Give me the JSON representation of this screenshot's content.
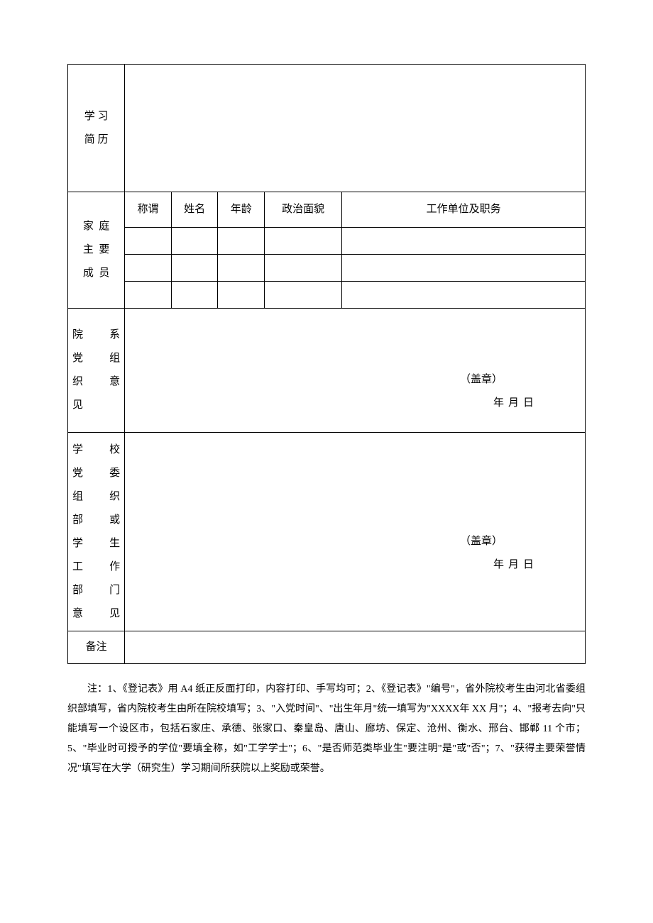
{
  "labels": {
    "study_resume": "学  习\n简  历",
    "family": "家  庭主  要成  员",
    "dept_opinion": "院系党组织意见",
    "school_opinion": "学校党委组织部或学生工作部门意见",
    "remark": "备注"
  },
  "family_headers": {
    "relation": "称谓",
    "name": "姓名",
    "age": "年龄",
    "political": "政治面貌",
    "work": "工作单位及职务"
  },
  "stamp": "（盖章）",
  "date": "年月日",
  "notes_text": "注：1、《登记表》用 A4 纸正反面打印，内容打印、手写均可；2、《登记表》\"编号\"，省外院校考生由河北省委组织部填写，省内院校考生由所在院校填写；3、\"入党时间\"、\"出生年月\"统一填写为\"XXXX年 XX 月\"；4、\"报考去向\"只能填写一个设区市，包括石家庄、承德、张家口、秦皇岛、唐山、廊坊、保定、沧州、衡水、邢台、邯郸 11 个市；5、\"毕业时可授予的学位\"要填全称，如\"工学学士\"；6、\"是否师范类毕业生\"要注明\"是\"或\"否\"；7、\"获得主要荣誉情况\"填写在大学（研究生）学习期间所获院以上奖励或荣誉。"
}
